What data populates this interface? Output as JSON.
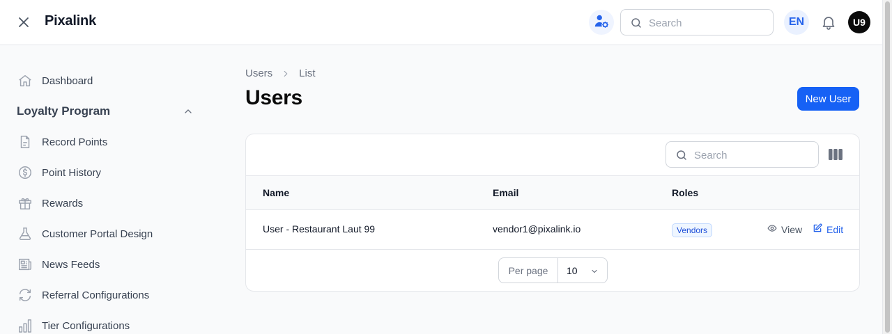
{
  "app": {
    "name": "Pixalink"
  },
  "header": {
    "search_placeholder": "Search",
    "language": "EN",
    "user_initials": "U9"
  },
  "sidebar": {
    "dashboard": "Dashboard",
    "group_title": "Loyalty Program",
    "items": [
      {
        "label": "Record Points",
        "icon": "document-icon"
      },
      {
        "label": "Point History",
        "icon": "dollar-circle-icon"
      },
      {
        "label": "Rewards",
        "icon": "gift-icon"
      },
      {
        "label": "Customer Portal Design",
        "icon": "flask-icon"
      },
      {
        "label": "News Feeds",
        "icon": "newspaper-icon"
      },
      {
        "label": "Referral Configurations",
        "icon": "refresh-icon"
      },
      {
        "label": "Tier Configurations",
        "icon": "bar-chart-icon"
      }
    ]
  },
  "breadcrumb": {
    "parent": "Users",
    "current": "List"
  },
  "page": {
    "title": "Users",
    "new_button": "New User"
  },
  "table": {
    "search_placeholder": "Search",
    "columns": [
      "Name",
      "Email",
      "Roles"
    ],
    "rows": [
      {
        "name": "User - Restaurant Laut 99",
        "email": "vendor1@pixalink.io",
        "role": "Vendors",
        "view_label": "View",
        "edit_label": "Edit"
      }
    ],
    "per_page_label": "Per page",
    "per_page_value": "10"
  },
  "colors": {
    "accent": "#1661f5",
    "badge_text": "#1d4ed8",
    "badge_bg": "#eff6ff"
  }
}
